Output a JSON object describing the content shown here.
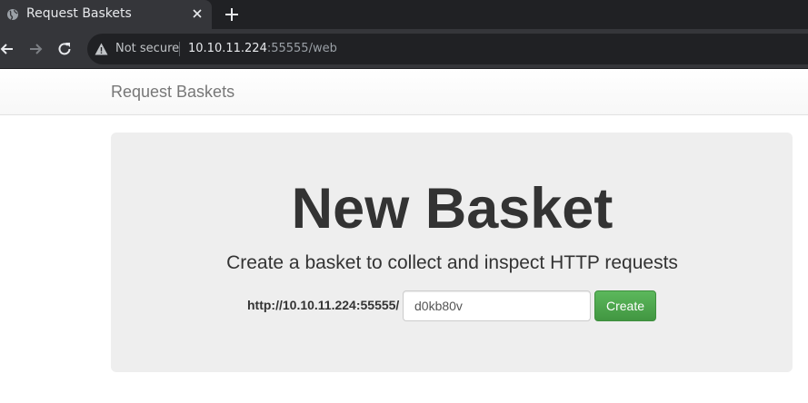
{
  "browser": {
    "tab_title": "Request Baskets",
    "security_label": "Not secure",
    "url_host": "10.10.11.224",
    "url_rest": ":55555/web"
  },
  "navbar": {
    "brand": "Request Baskets"
  },
  "jumbotron": {
    "title": "New Basket",
    "subtitle": "Create a basket to collect and inspect HTTP requests"
  },
  "form": {
    "base_url_label": "http://10.10.11.224:55555/",
    "basket_name_value": "d0kb80v",
    "create_label": "Create"
  },
  "colors": {
    "tabstrip": "#202124",
    "toolbar": "#35363a",
    "jumbotron": "#eeeeee",
    "create_button": "#5cb85c"
  }
}
